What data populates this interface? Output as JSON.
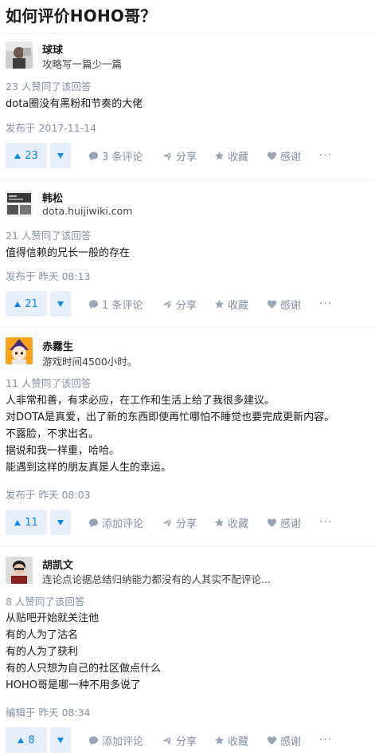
{
  "question": {
    "title": "如何评价HOHO哥？"
  },
  "colors": {
    "accent": "#0f88eb",
    "muted": "#8590a6",
    "vote_bg": "#e5eef9",
    "divider": "#ebebeb"
  },
  "answers": [
    {
      "author": {
        "name": "球球",
        "bio": "攻略写一篇少一篇"
      },
      "vote_summary": "23 人赞同了该回答",
      "content": [
        "dota圈没有黑粉和节奏的大佬"
      ],
      "time": "发布于 2017-11-14",
      "actions": {
        "upvotes": "23",
        "comment": "3 条评论",
        "share": "分享",
        "favorite": "收藏",
        "thanks": "感谢",
        "more": "···"
      }
    },
    {
      "author": {
        "name": "韩松",
        "bio": "dota.huijiwiki.com"
      },
      "vote_summary": "21 人赞同了该回答",
      "content": [
        "值得信赖的兄长一般的存在"
      ],
      "time": "发布于 昨天 08:13",
      "actions": {
        "upvotes": "21",
        "comment": "1 条评论",
        "share": "分享",
        "favorite": "收藏",
        "thanks": "感谢",
        "more": "···"
      }
    },
    {
      "author": {
        "name": "赤霧生",
        "bio": "游戏时间4500小时。"
      },
      "vote_summary": "11 人赞同了该回答",
      "content": [
        "人非常和善，有求必应，在工作和生活上给了我很多建议。",
        "对DOTA是真爱，出了新的东西即使再忙哪怕不睡觉也要完成更新内容。",
        "不露脸，不求出名。",
        "据说和我一样重，哈哈。",
        "能遇到这样的朋友真是人生的幸运。"
      ],
      "time": "发布于 昨天 08:03",
      "actions": {
        "upvotes": "11",
        "comment": "添加评论",
        "share": "分享",
        "favorite": "收藏",
        "thanks": "感谢",
        "more": "···"
      }
    },
    {
      "author": {
        "name": "胡凯文",
        "bio": "连论点论据总结归纳能力都没有的人其实不配评论..."
      },
      "vote_summary": "8 人赞同了该回答",
      "content": [
        "从贴吧开始就关注他",
        "有的人为了沽名",
        "有的人为了获利",
        "有的人只想为自己的社区做点什么",
        "HOHO哥是哪一种不用多说了"
      ],
      "time": "编辑于 昨天 08:34",
      "actions": {
        "upvotes": "8",
        "comment": "添加评论",
        "share": "分享",
        "favorite": "收藏",
        "thanks": "感谢",
        "more": "···"
      }
    }
  ]
}
